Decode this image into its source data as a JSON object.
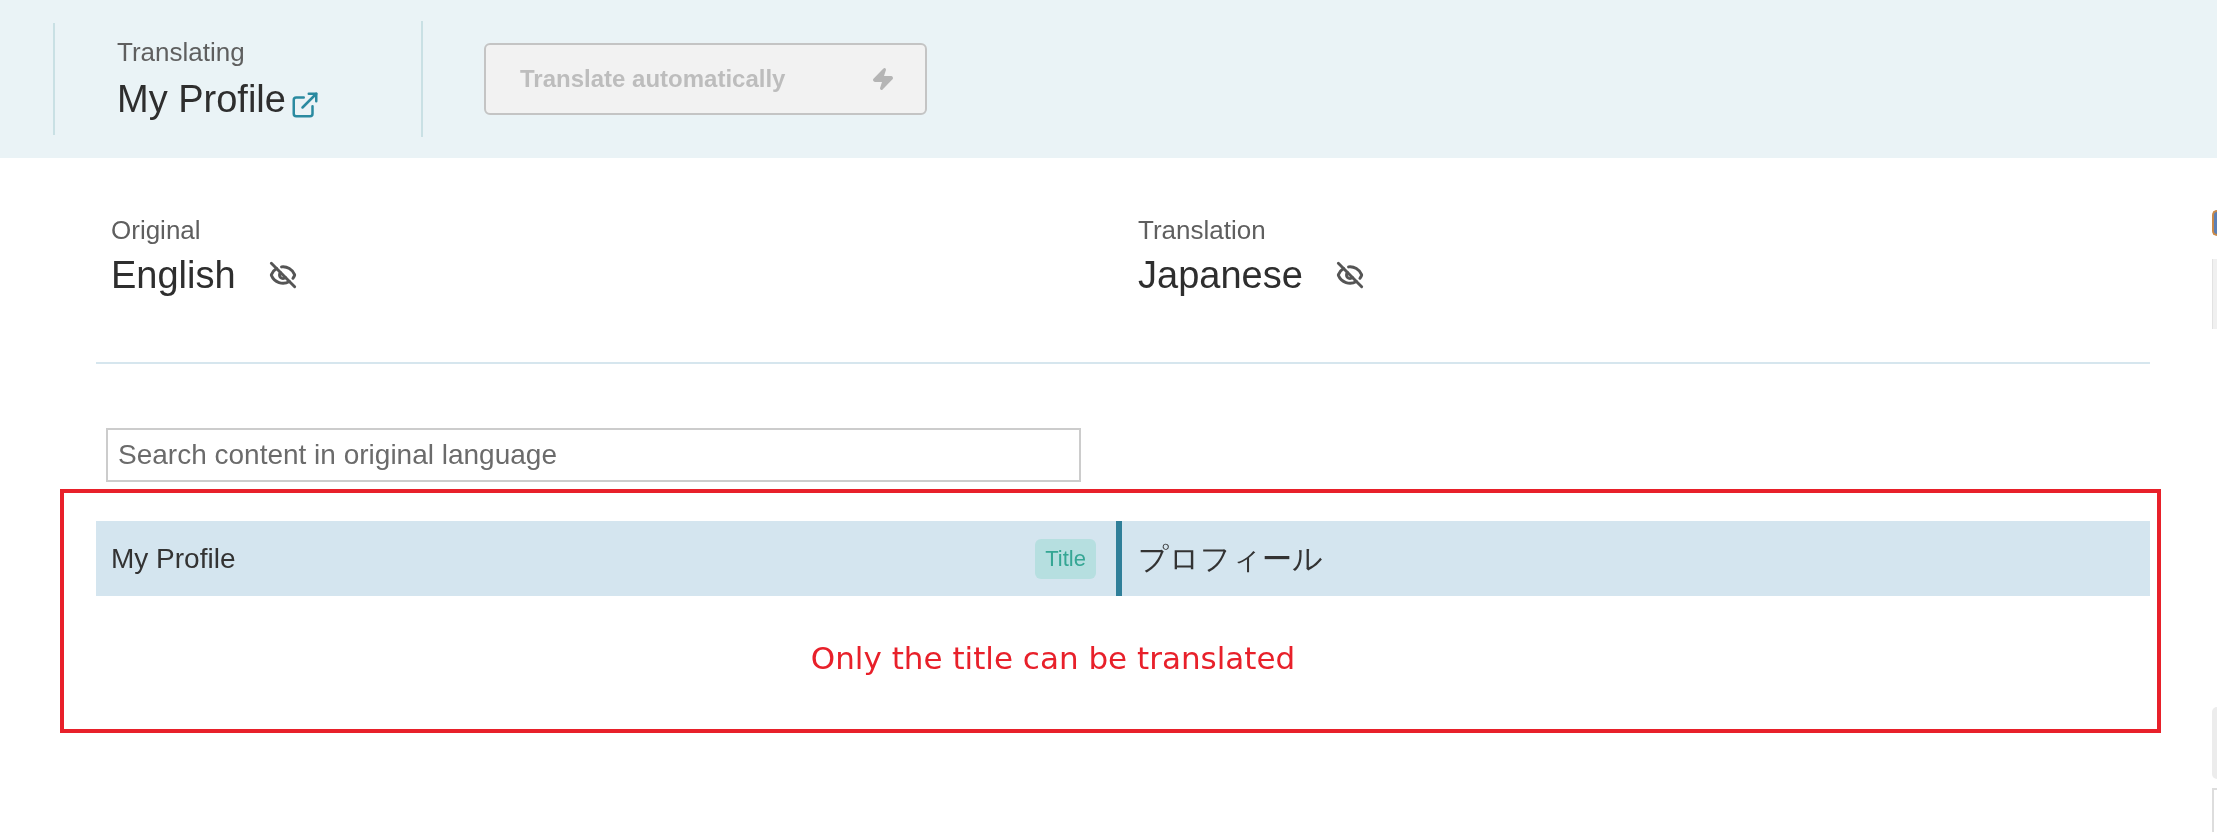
{
  "header": {
    "eyebrow": "Translating",
    "title": "My Profile",
    "auto_translate_button": {
      "label": "Translate automatically",
      "disabled": true
    }
  },
  "languages": [
    {
      "role": "Original",
      "name": "English"
    },
    {
      "role": "Translation",
      "name": "Japanese"
    }
  ],
  "search": {
    "placeholder": "Search content in original language"
  },
  "rows": [
    {
      "original": "My Profile",
      "tag": "Title",
      "translation": "プロフィール",
      "selected": true
    }
  ],
  "annotation": "Only the title can be translated"
}
